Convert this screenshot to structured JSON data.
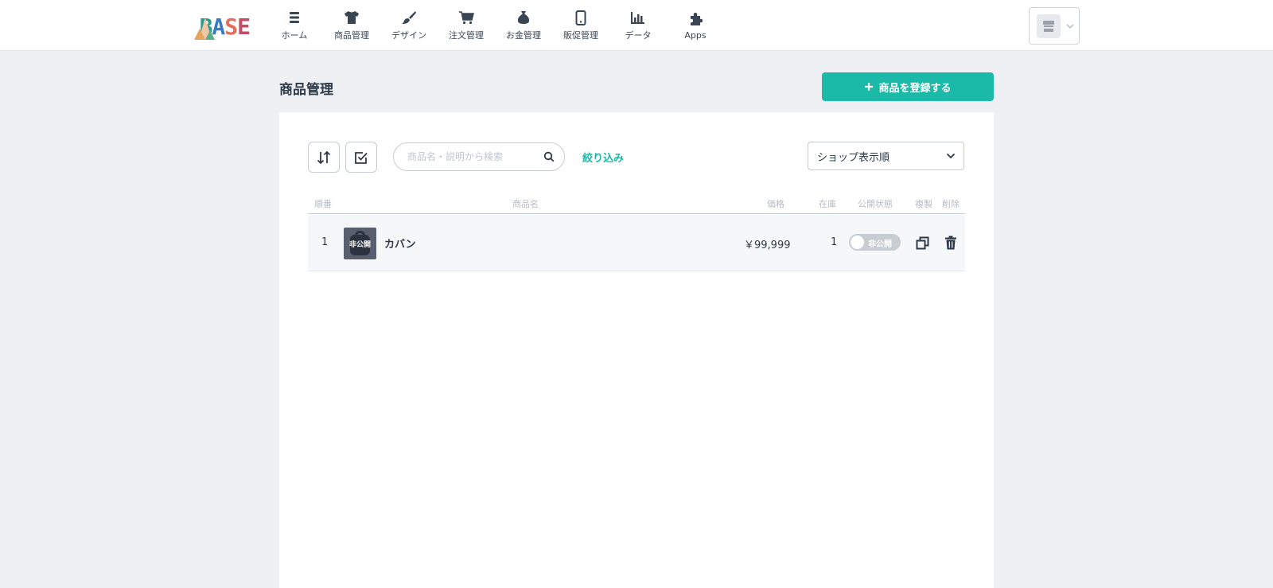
{
  "header": {
    "logo_text": "BASE",
    "nav": [
      {
        "label": "ホーム",
        "icon": "list-icon"
      },
      {
        "label": "商品管理",
        "icon": "tshirt-icon"
      },
      {
        "label": "デザイン",
        "icon": "brush-icon"
      },
      {
        "label": "注文管理",
        "icon": "cart-icon"
      },
      {
        "label": "お金管理",
        "icon": "money-bag-icon"
      },
      {
        "label": "販促管理",
        "icon": "smartphone-icon"
      },
      {
        "label": "データ",
        "icon": "bar-chart-icon"
      },
      {
        "label": "Apps",
        "icon": "puzzle-icon"
      }
    ]
  },
  "page": {
    "title": "商品管理",
    "add_button": "商品を登録する"
  },
  "toolbar": {
    "search_placeholder": "商品名・説明から検索",
    "filter": "絞り込み",
    "sort_selected": "ショップ表示順"
  },
  "table": {
    "columns": {
      "order": "順番",
      "name": "商品名",
      "price": "価格",
      "stock": "在庫",
      "status": "公開状態",
      "duplicate": "複製",
      "delete": "削除"
    },
    "rows": [
      {
        "order": "1",
        "thumb_label": "非公開",
        "name": "カバン",
        "price": "￥99,999",
        "stock": "1",
        "status": "非公開",
        "published": false
      }
    ]
  },
  "colors": {
    "accent": "#1bb9a7",
    "text": "#2e3a48",
    "background": "#eef0f4"
  }
}
